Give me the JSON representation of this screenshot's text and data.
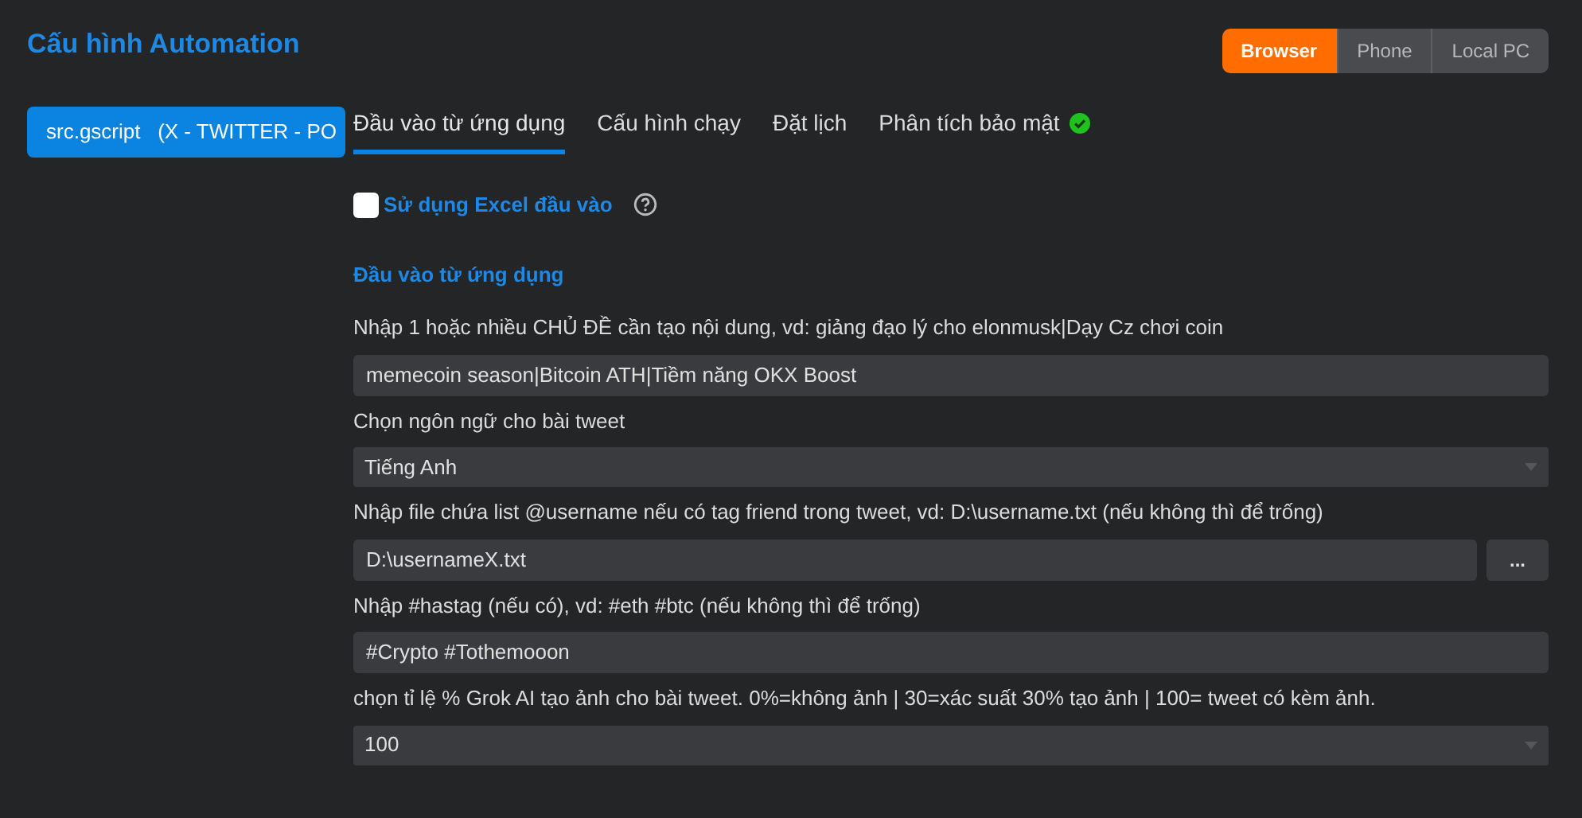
{
  "title": "Cấu hình Automation",
  "modes": [
    {
      "label": "Browser",
      "selected": true
    },
    {
      "label": "Phone",
      "selected": false
    },
    {
      "label": "Local PC",
      "selected": false
    }
  ],
  "sidebar": {
    "items": [
      {
        "label": "src.gscript   (X - TWITTER - PO",
        "selected": true
      }
    ]
  },
  "tabs": [
    {
      "label": "Đầu vào từ ứng dụng",
      "selected": true,
      "verified": false
    },
    {
      "label": "Cấu hình chạy",
      "selected": false,
      "verified": false
    },
    {
      "label": "Đặt lịch",
      "selected": false,
      "verified": false
    },
    {
      "label": "Phân tích bảo mật",
      "selected": false,
      "verified": true
    }
  ],
  "excel_option": {
    "label": "Sử dụng Excel đầu vào",
    "checked": false
  },
  "section_title": "Đầu vào từ ứng dụng",
  "fields": [
    {
      "kind": "text",
      "label": "Nhập 1 hoặc nhiều CHỦ ĐỀ cần tạo nội dung, vd: giảng đạo lý cho elonmusk|Dạy Cz chơi coin",
      "value": "memecoin season|Bitcoin ATH|Tiềm năng OKX Boost"
    },
    {
      "kind": "select",
      "label": "Chọn ngôn ngữ cho bài tweet",
      "value": "Tiếng Anh"
    },
    {
      "kind": "file",
      "label": "Nhập file chứa list @username nếu có tag friend trong tweet, vd: D:\\username.txt (nếu không thì để trống)",
      "value": "D:\\usernameX.txt",
      "button": "..."
    },
    {
      "kind": "text",
      "label": "Nhập #hastag (nếu có), vd: #eth #btc (nếu không thì để trống)",
      "value": "#Crypto #Tothemooon"
    },
    {
      "kind": "select",
      "label": "chọn tỉ lệ % Grok AI tạo ảnh cho bài tweet. 0%=không ảnh | 30=xác suất 30% tạo ảnh | 100= tweet có kèm ảnh.",
      "value": "100"
    }
  ]
}
